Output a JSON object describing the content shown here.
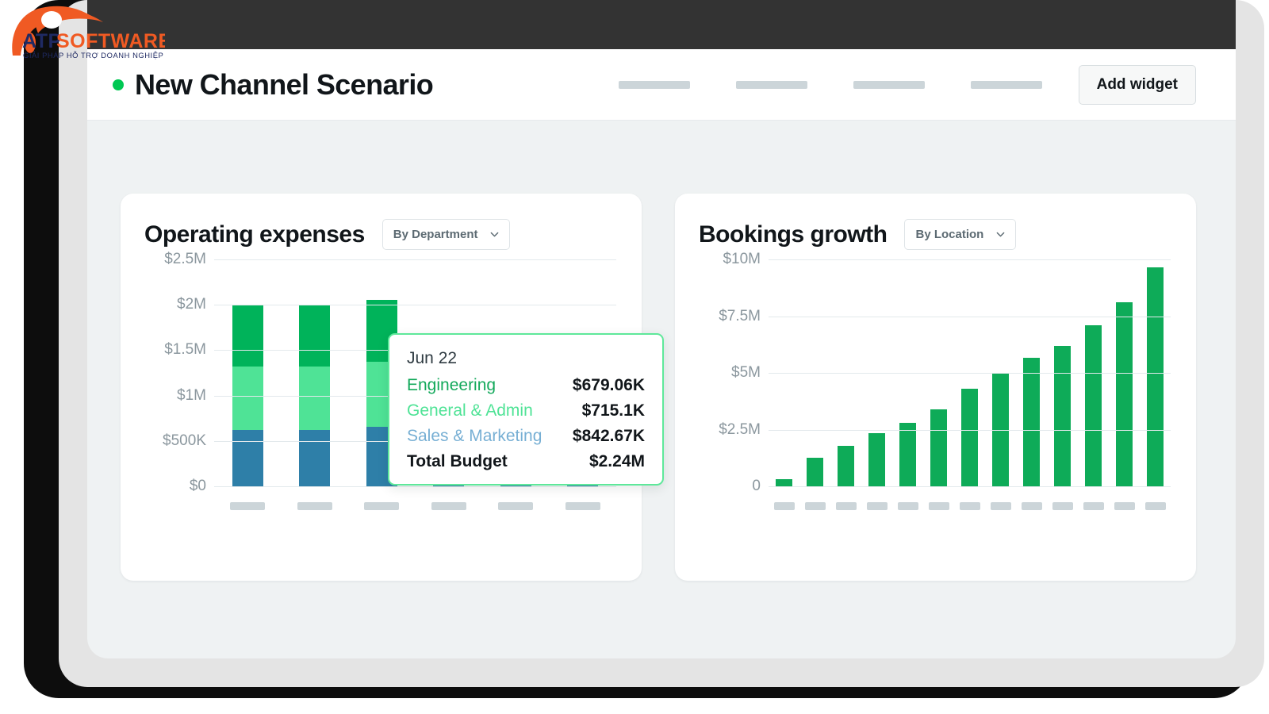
{
  "logo": {
    "brand_first": "ATP",
    "brand_second": "SOFTWARE",
    "tagline": "GIẢI PHÁP HỖ TRỢ DOANH NGHIỆP",
    "colors": {
      "navy": "#1f2a63",
      "orange": "#f05a23"
    }
  },
  "header": {
    "scenario_title": "New Channel Scenario",
    "status_dot_color": "#00c853",
    "nav_placeholder_count": 4,
    "add_widget_label": "Add widget"
  },
  "cards": {
    "operating_expenses": {
      "title": "Operating expenses",
      "dropdown_label": "By Department"
    },
    "bookings_growth": {
      "title": "Bookings growth",
      "dropdown_label": "By Location"
    }
  },
  "tooltip": {
    "date": "Jun 22",
    "rows": [
      {
        "name": "Engineering",
        "value": "$679.06K",
        "color": "#13a95b"
      },
      {
        "name": "General & Admin",
        "value": "$715.1K",
        "color": "#4fe396"
      },
      {
        "name": "Sales & Marketing",
        "value": "$842.67K",
        "color": "#77afd4"
      }
    ],
    "total_label": "Total Budget",
    "total_value": "$2.24M",
    "border_color": "#5ee89a"
  },
  "chart_data": [
    {
      "type": "bar",
      "id": "operating-expenses",
      "title": "Operating expenses",
      "stacked": true,
      "xlabel": "",
      "ylabel": "",
      "ylim": [
        0,
        2500000
      ],
      "grid": true,
      "legend": "none",
      "ytick_labels": [
        "$2.5M",
        "$2M",
        "$1.5M",
        "$1M",
        "$500K",
        "$0"
      ],
      "ytick_values": [
        2500000,
        2000000,
        1500000,
        1000000,
        500000,
        0
      ],
      "categories": [
        "",
        "",
        "Jun 22",
        "",
        "",
        ""
      ],
      "xtick_labels_hidden": true,
      "series": [
        {
          "name": "Sales & Marketing",
          "color": "#2e7fa8",
          "values": [
            620000,
            620000,
            660000,
            620000,
            620000,
            620000
          ]
        },
        {
          "name": "General & Admin",
          "color": "#4fe396",
          "values": [
            700000,
            700000,
            715100,
            0,
            0,
            0
          ]
        },
        {
          "name": "Engineering",
          "color": "#00b35a",
          "values": [
            680000,
            680000,
            679060,
            0,
            0,
            0
          ]
        }
      ],
      "note": "Bars 4-6 upper segments are occluded by the tooltip overlay"
    },
    {
      "type": "bar",
      "id": "bookings-growth",
      "title": "Bookings growth",
      "stacked": false,
      "xlabel": "",
      "ylabel": "",
      "ylim": [
        0,
        10000000
      ],
      "grid": true,
      "legend": "none",
      "ytick_labels": [
        "$10M",
        "$7.5M",
        "$5M",
        "$2.5M",
        "0"
      ],
      "ytick_values": [
        10000000,
        7500000,
        5000000,
        2500000,
        0
      ],
      "categories": [
        "",
        "",
        "",
        "",
        "",
        "",
        "",
        "",
        "",
        "",
        "",
        "",
        ""
      ],
      "xtick_labels_hidden": true,
      "bar_color": "#0eab58",
      "values": [
        300000,
        1250000,
        1800000,
        2350000,
        2800000,
        3400000,
        4300000,
        4950000,
        5650000,
        6200000,
        7100000,
        8100000,
        9650000
      ]
    }
  ]
}
